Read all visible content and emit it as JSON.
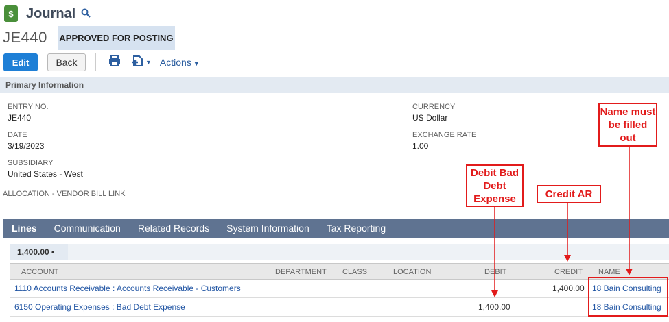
{
  "header": {
    "app_icon_glyph": "$",
    "title": "Journal"
  },
  "record": {
    "number": "JE440",
    "status": "APPROVED FOR POSTING"
  },
  "toolbar": {
    "edit_label": "Edit",
    "back_label": "Back",
    "actions_label": "Actions"
  },
  "primary": {
    "section_title": "Primary Information",
    "entry_no_label": "ENTRY NO.",
    "entry_no": "JE440",
    "date_label": "DATE",
    "date": "3/19/2023",
    "subsidiary_label": "SUBSIDIARY",
    "subsidiary": "United States - West",
    "allocation_label": "ALLOCATION - VENDOR BILL LINK",
    "currency_label": "CURRENCY",
    "currency": "US Dollar",
    "exchange_rate_label": "EXCHANGE RATE",
    "exchange_rate": "1.00"
  },
  "tabs": [
    {
      "label": "Lines"
    },
    {
      "label": "Communication"
    },
    {
      "label": "Related Records"
    },
    {
      "label": "System Information"
    },
    {
      "label": "Tax Reporting"
    }
  ],
  "lines": {
    "subtotal": "1,400.00 •",
    "columns": [
      "ACCOUNT",
      "DEPARTMENT",
      "CLASS",
      "LOCATION",
      "DEBIT",
      "CREDIT",
      "NAME"
    ],
    "rows": [
      {
        "account": "1110 Accounts Receivable : Accounts Receivable - Customers",
        "debit": "",
        "credit": "1,400.00",
        "name": "18 Bain Consulting"
      },
      {
        "account": "6150 Operating Expenses : Bad Debt Expense",
        "debit": "1,400.00",
        "credit": "",
        "name": "18 Bain Consulting"
      }
    ]
  },
  "callouts": {
    "debit": "Debit Bad Debt Expense",
    "credit": "Credit AR",
    "name": "Name must be filled out"
  },
  "colors": {
    "accent": "#1e7fd6",
    "tab_bar": "#5f7391",
    "callout": "#e21b1b",
    "link": "#2256a4"
  }
}
